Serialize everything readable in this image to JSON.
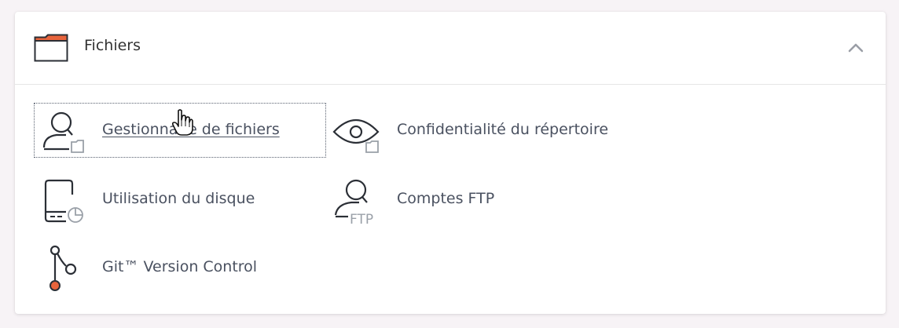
{
  "section": {
    "title": "Fichiers",
    "header_icon": "folder-icon",
    "collapse_icon": "chevron-up-icon"
  },
  "items": [
    {
      "label": "Gestionnaire de fichiers",
      "icon": "file-manager-icon",
      "focused": true
    },
    {
      "label": "Confidentialité du répertoire",
      "icon": "directory-privacy-icon"
    },
    {
      "label": "Utilisation du disque",
      "icon": "disk-usage-icon"
    },
    {
      "label": "Comptes FTP",
      "icon": "ftp-accounts-icon",
      "icon_text": "FTP"
    },
    {
      "label": "Git™ Version Control",
      "icon": "git-version-control-icon"
    }
  ],
  "colors": {
    "icon_stroke": "#2b2f36",
    "icon_accent": "#9aa0a8",
    "git_accent": "#e8643c",
    "folder_accent": "#e8643c"
  }
}
